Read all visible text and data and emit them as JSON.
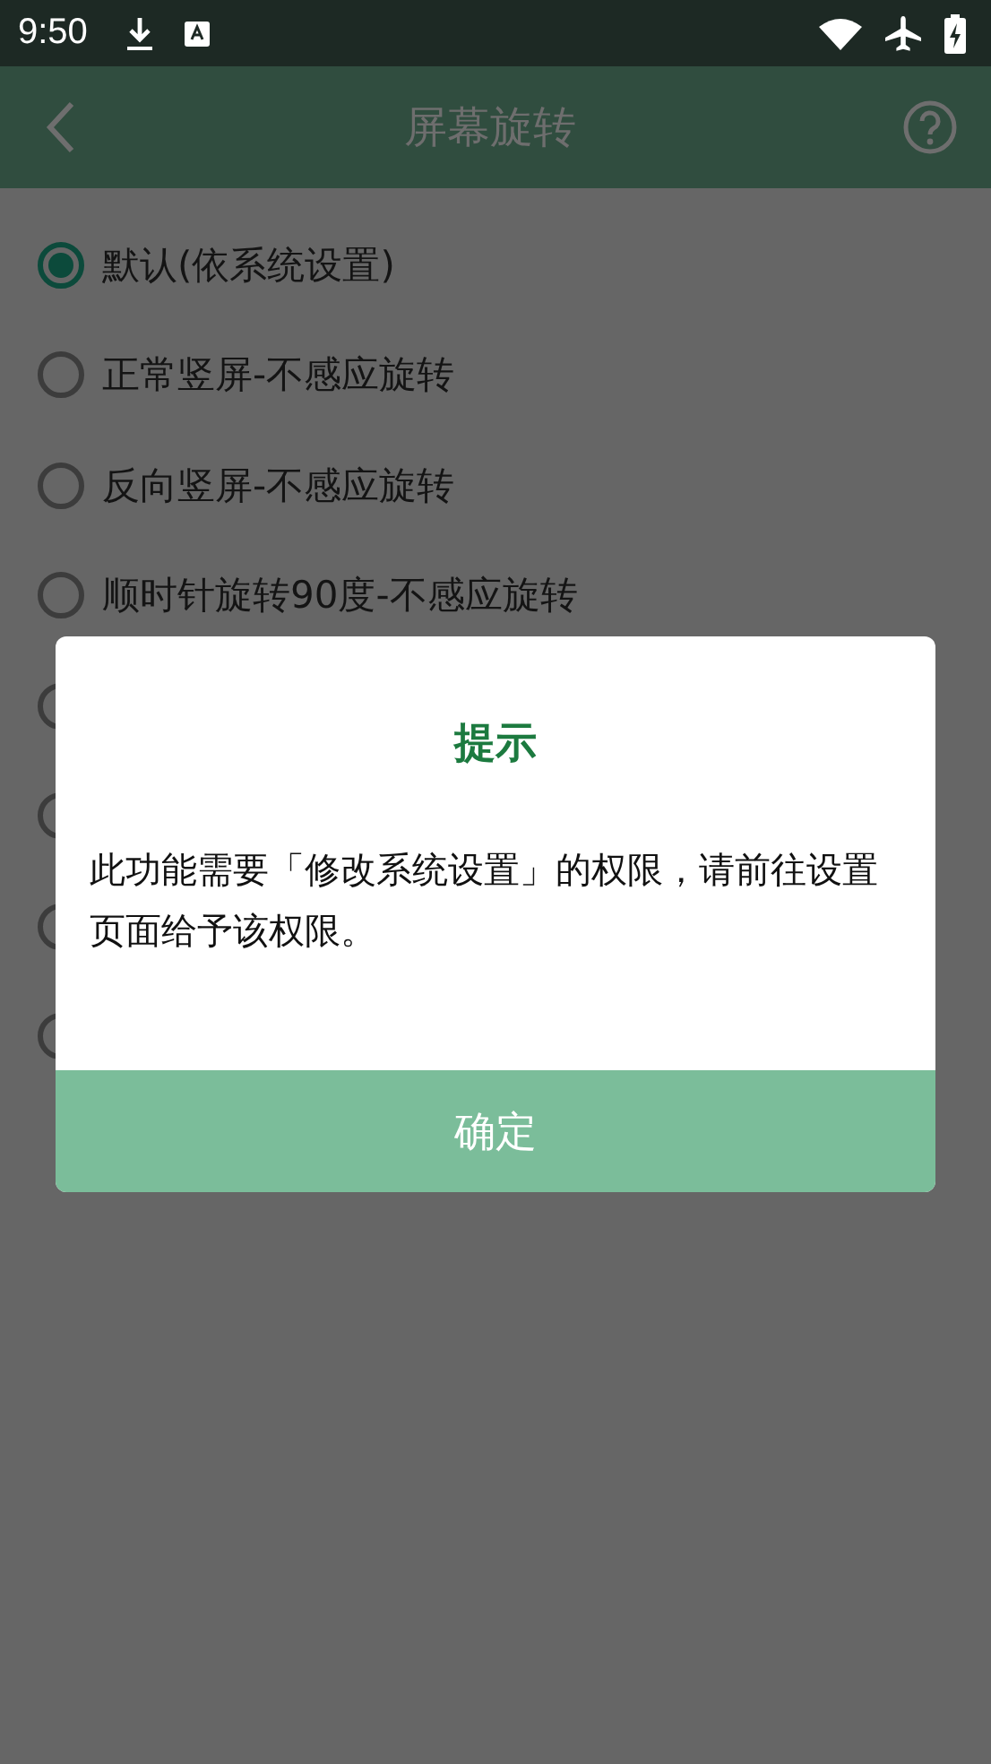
{
  "status_bar": {
    "time": "9:50"
  },
  "app_bar": {
    "title": "屏幕旋转"
  },
  "options": [
    {
      "label": "默认(依系统设置)",
      "selected": true
    },
    {
      "label": "正常竖屏-不感应旋转",
      "selected": false
    },
    {
      "label": "反向竖屏-不感应旋转",
      "selected": false
    },
    {
      "label": "顺时针旋转90度-不感应旋转",
      "selected": false
    },
    {
      "selected": false
    },
    {
      "selected": false
    },
    {
      "selected": false
    },
    {
      "selected": false
    }
  ],
  "dialog": {
    "title": "提示",
    "message": "此功能需要「修改系统设置」的权限，请前往设置页面给予该权限。",
    "button": "确定"
  }
}
